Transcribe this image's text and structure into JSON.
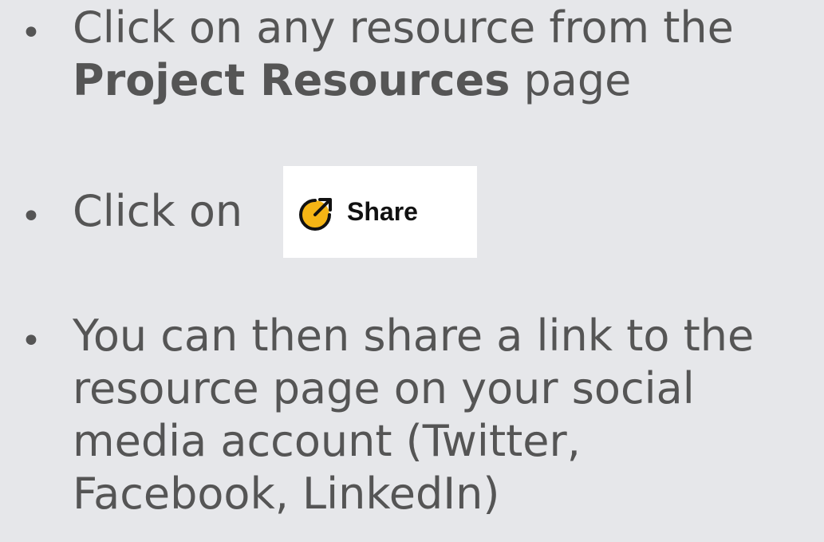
{
  "bullets": [
    {
      "text_before": "Click on any resource from the",
      "bold": "Project Resources",
      "text_after": " page"
    },
    {
      "text": "Click on"
    },
    {
      "lines": [
        "You can then share a link to the",
        "resource page on your social",
        "media account (Twitter,",
        "Facebook, LinkedIn)"
      ]
    }
  ],
  "share_button": {
    "label": "Share",
    "icon": "share-arrow-icon",
    "icon_color": "#f5b515",
    "background": "#ffffff"
  },
  "colors": {
    "background": "#e6e7ea",
    "text": "#555555"
  },
  "bullet_char": "•"
}
